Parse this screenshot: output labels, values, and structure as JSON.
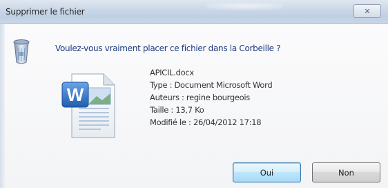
{
  "window": {
    "title": "Supprimer le fichier",
    "close_label": "✕"
  },
  "dialog": {
    "question": "Voulez-vous vraiment placer ce fichier dans la Corbeille ?"
  },
  "file": {
    "name": "APICIL.docx",
    "type": "Type : Document Microsoft Word",
    "authors": "Auteurs : regine bourgeois",
    "size": "Taille : 13,7 Ko",
    "modified": "Modifié le : 26/04/2012 17:18"
  },
  "buttons": {
    "yes": "Oui",
    "no": "Non"
  },
  "icons": {
    "recycle_bin": "recycle-bin-icon",
    "file": "word-document-icon",
    "close": "close-icon"
  },
  "colors": {
    "question_text": "#1c3b82",
    "default_button_border": "#3c7fb1"
  }
}
